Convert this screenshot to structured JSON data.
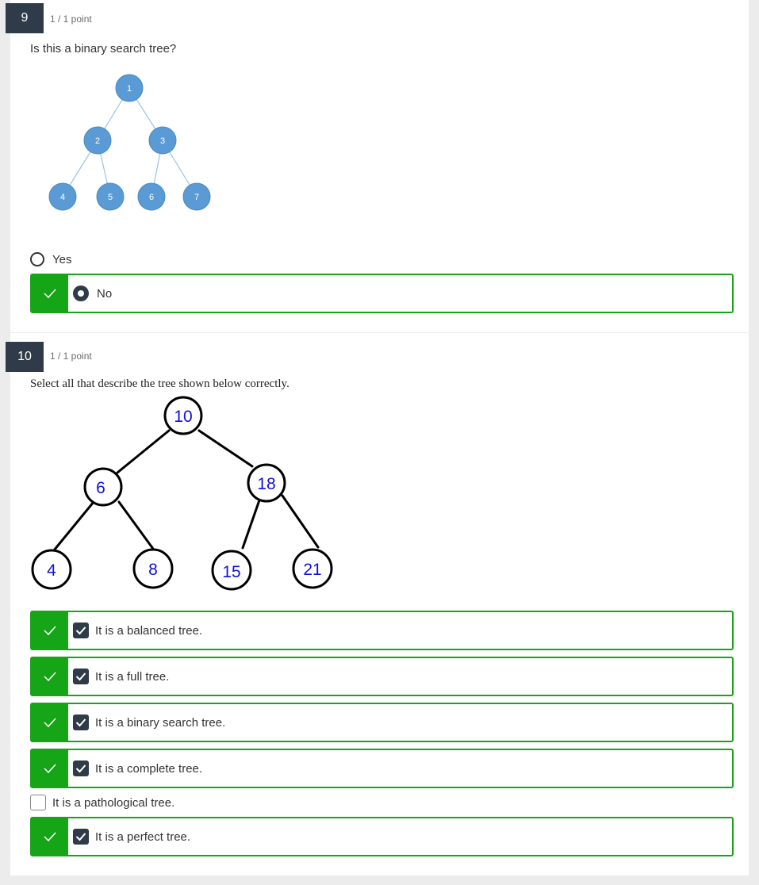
{
  "q9": {
    "number": "9",
    "points": "1 / 1 point",
    "prompt": "Is this a binary search tree?",
    "tree_nodes": [
      "1",
      "2",
      "3",
      "4",
      "5",
      "6",
      "7"
    ],
    "options": [
      {
        "label": "Yes",
        "selected": false,
        "correct": false
      },
      {
        "label": "No",
        "selected": true,
        "correct": true
      }
    ]
  },
  "q10": {
    "number": "10",
    "points": "1 / 1 point",
    "prompt": "Select all that describe the tree shown below correctly.",
    "tree_nodes": [
      "10",
      "6",
      "18",
      "4",
      "8",
      "15",
      "21"
    ],
    "options": [
      {
        "label": "It is a balanced tree.",
        "checked": true,
        "correct": true
      },
      {
        "label": "It is a full tree.",
        "checked": true,
        "correct": true
      },
      {
        "label": "It is a binary search tree.",
        "checked": true,
        "correct": true
      },
      {
        "label": "It is a complete tree.",
        "checked": true,
        "correct": true
      },
      {
        "label": "It is a pathological tree.",
        "checked": false,
        "correct": false
      },
      {
        "label": "It is a perfect tree.",
        "checked": true,
        "correct": true
      }
    ]
  },
  "colors": {
    "correct_green": "#16a516",
    "badge_dark": "#2f3b48",
    "node_blue": "#5b9bd5",
    "handwritten_blue": "#1010e0"
  }
}
